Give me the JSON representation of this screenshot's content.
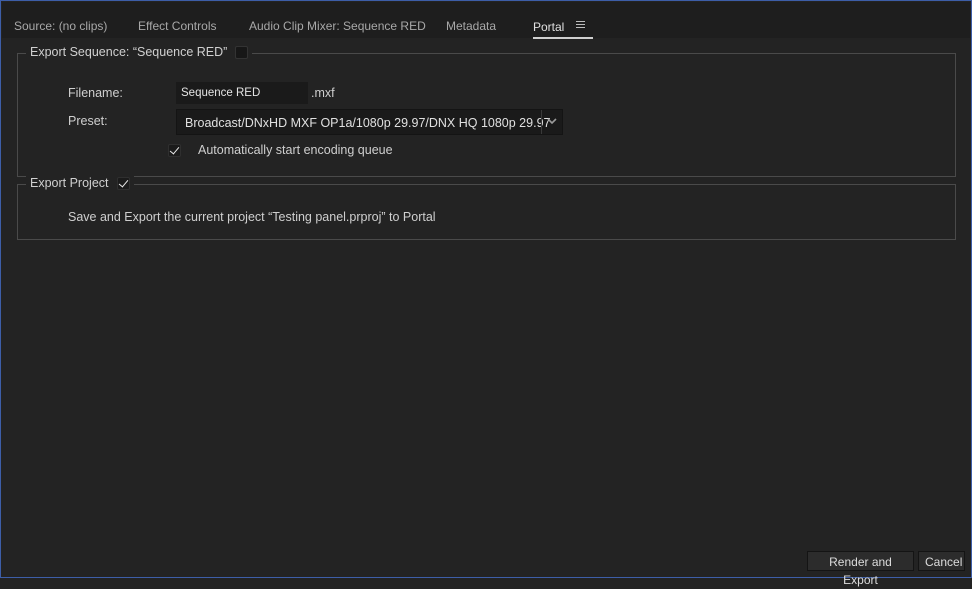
{
  "tabs": [
    {
      "label": "Source: (no clips)",
      "active": false
    },
    {
      "label": "Effect Controls",
      "active": false
    },
    {
      "label": "Audio Clip Mixer: Sequence RED",
      "active": false
    },
    {
      "label": "Metadata",
      "active": false
    },
    {
      "label": "Portal",
      "active": true
    }
  ],
  "export_sequence": {
    "legend": "Export Sequence: “Sequence RED”",
    "checked": false,
    "filename_label": "Filename:",
    "filename_value": "Sequence RED",
    "filename_ext": ".mxf",
    "preset_label": "Preset:",
    "preset_value": "Broadcast/DNxHD MXF OP1a/1080p 29.97/DNX HQ 1080p 29.97",
    "auto_encode_label": "Automatically start encoding queue",
    "auto_encode_checked": true
  },
  "export_project": {
    "legend": "Export Project",
    "checked": true,
    "description": "Save and Export the current project “Testing panel.prproj” to Portal"
  },
  "buttons": {
    "render_export": "Render and Export",
    "cancel": "Cancel"
  },
  "icons": {
    "panel_menu": "hamburger-menu-icon",
    "dropdown": "chevron-down-icon"
  }
}
